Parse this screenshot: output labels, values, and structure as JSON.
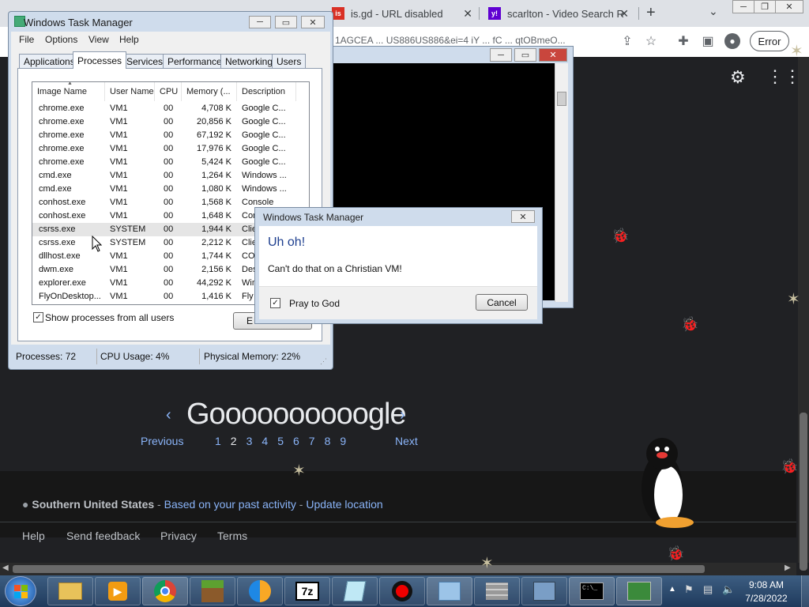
{
  "browser": {
    "tabs": [
      {
        "label": "is.gd - URL disabled",
        "favicon": "is"
      },
      {
        "label": "scarlton - Video Search R",
        "favicon": "y!"
      }
    ],
    "address_fragment": "1AGCEA ... US886US886&ei=4 iY ... fC ... qtOBmeO...",
    "error_label": "Error",
    "new_tab": "+"
  },
  "google": {
    "logo": "Goooooooooogle",
    "prev": "Previous",
    "next": "Next",
    "pages": [
      "1",
      "2",
      "3",
      "4",
      "5",
      "6",
      "7",
      "8",
      "9"
    ],
    "location": "Southern United States",
    "location_sep1": " - ",
    "based_on": "Based on your past activity",
    "location_sep2": " - ",
    "update_location": "Update location",
    "footer_links": [
      "Help",
      "Send feedback",
      "Privacy",
      "Terms"
    ]
  },
  "taskmanager": {
    "title": "Windows Task Manager",
    "menu": [
      "File",
      "Options",
      "View",
      "Help"
    ],
    "tabs": [
      "Applications",
      "Processes",
      "Services",
      "Performance",
      "Networking",
      "Users"
    ],
    "active_tab": "Processes",
    "columns": [
      "Image Name",
      "User Name",
      "CPU",
      "Memory (...",
      "Description"
    ],
    "rows": [
      [
        "chrome.exe",
        "VM1",
        "00",
        "4,708 K",
        "Google C..."
      ],
      [
        "chrome.exe",
        "VM1",
        "00",
        "20,856 K",
        "Google C..."
      ],
      [
        "chrome.exe",
        "VM1",
        "00",
        "67,192 K",
        "Google C..."
      ],
      [
        "chrome.exe",
        "VM1",
        "00",
        "17,976 K",
        "Google C..."
      ],
      [
        "chrome.exe",
        "VM1",
        "00",
        "5,424 K",
        "Google C..."
      ],
      [
        "cmd.exe",
        "VM1",
        "00",
        "1,264 K",
        "Windows ..."
      ],
      [
        "cmd.exe",
        "VM1",
        "00",
        "1,080 K",
        "Windows ..."
      ],
      [
        "conhost.exe",
        "VM1",
        "00",
        "1,568 K",
        "Console"
      ],
      [
        "conhost.exe",
        "VM1",
        "00",
        "1,648 K",
        "Con"
      ],
      [
        "csrss.exe",
        "SYSTEM",
        "00",
        "1,944 K",
        "Clie"
      ],
      [
        "csrss.exe",
        "SYSTEM",
        "00",
        "2,212 K",
        "Clie"
      ],
      [
        "dllhost.exe",
        "VM1",
        "00",
        "1,744 K",
        "CO"
      ],
      [
        "dwm.exe",
        "VM1",
        "00",
        "2,156 K",
        "Des"
      ],
      [
        "explorer.exe",
        "VM1",
        "00",
        "44,292 K",
        "Win"
      ],
      [
        "FlyOnDesktop...",
        "VM1",
        "00",
        "1,416 K",
        "Fly"
      ]
    ],
    "selected_row": 9,
    "show_all": "Show processes from all users",
    "end_process": "E",
    "status": {
      "processes": "Processes: 72",
      "cpu": "CPU Usage: 4%",
      "memory": "Physical Memory: 22%"
    }
  },
  "dialog": {
    "title": "Windows Task Manager",
    "heading": "Uh oh!",
    "message": "Can't do that on a Christian VM!",
    "checkbox": "Pray to God",
    "cancel": "Cancel"
  },
  "taskbar": {
    "time": "9:08 AM",
    "date": "7/28/2022",
    "apps": [
      "start",
      "explorer",
      "media",
      "chrome",
      "minecraft",
      "chromium",
      "7z",
      "notepad",
      "record",
      "control",
      "firewall",
      "network",
      "cmd",
      "taskmgr"
    ]
  },
  "colors": {
    "accent": "#8ab4f8",
    "dialog_heading": "#1e3f8f"
  }
}
